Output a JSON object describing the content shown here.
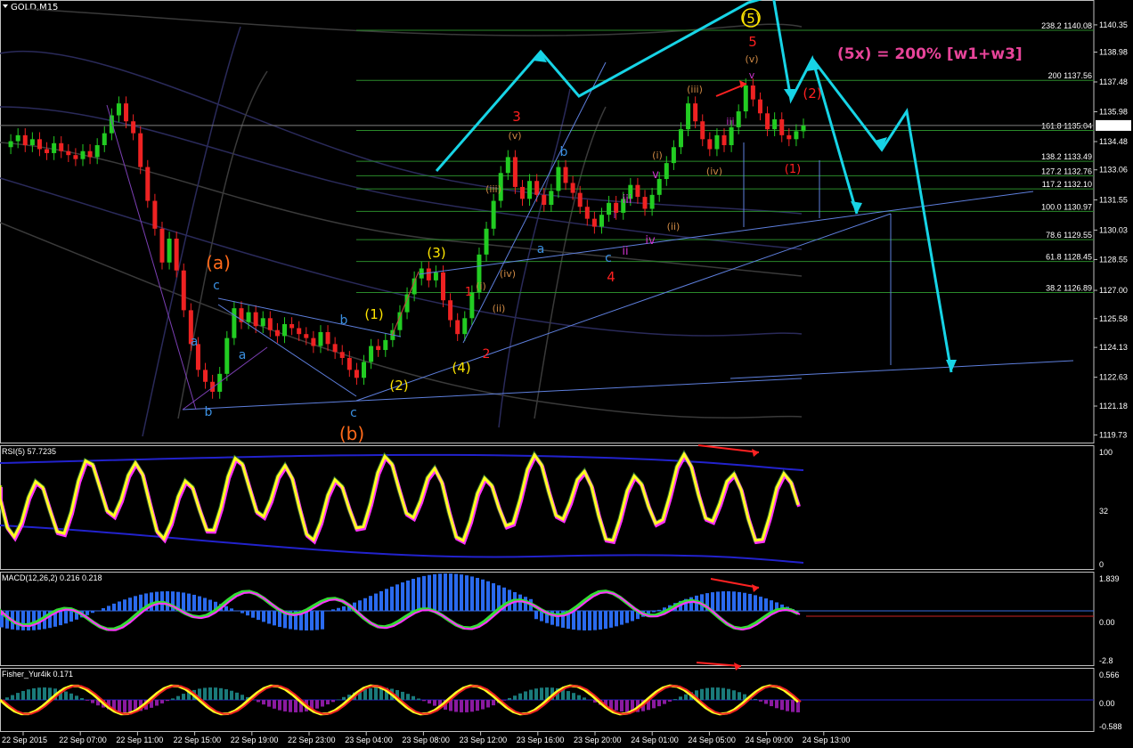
{
  "window": {
    "symbol_title": "GOLD,M15"
  },
  "annotation_main": "(5x)  = 200% [w1+w3]",
  "chart_data": {
    "type": "line",
    "title": "GOLD,M15",
    "price_axis": [
      "1140.35",
      "1138.98",
      "1137.48",
      "1135.98",
      "1134.48",
      "1133.06",
      "1131.55",
      "1130.03",
      "1128.55",
      "1127.00",
      "1125.58",
      "1124.13",
      "1122.63",
      "1121.18",
      "1119.73"
    ],
    "current_price": "1135.29",
    "fib_levels": [
      {
        "label": "238.2 1140.08",
        "price": 1140.08
      },
      {
        "label": "200 1137.56",
        "price": 1137.56
      },
      {
        "label": "161.8 1135.04",
        "price": 1135.04
      },
      {
        "label": "138.2 1133.49",
        "price": 1133.49
      },
      {
        "label": "127.2 1132.76",
        "price": 1132.76
      },
      {
        "label": "117.2 1132.10",
        "price": 1132.1
      },
      {
        "label": "100.0 1130.97",
        "price": 1130.97
      },
      {
        "label": "78.6 1129.55",
        "price": 1129.55
      },
      {
        "label": "61.8 1128.45",
        "price": 1128.45
      },
      {
        "label": "38.2 1126.89",
        "price": 1126.89
      }
    ],
    "date_axis": [
      "22 Sep 2015",
      "22 Sep 07:00",
      "22 Sep 11:00",
      "22 Sep 15:00",
      "22 Sep 19:00",
      "22 Sep 23:00",
      "23 Sep 04:00",
      "23 Sep 08:00",
      "23 Sep 12:00",
      "23 Sep 16:00",
      "23 Sep 20:00",
      "24 Sep 01:00",
      "24 Sep 05:00",
      "24 Sep 09:00",
      "24 Sep 13:00"
    ],
    "wave_labels": [
      "(a)",
      "(b)",
      "(1)",
      "(2)",
      "(3)",
      "(4)",
      "(5)",
      "(2)",
      "(1)",
      "1",
      "2",
      "3",
      "4",
      "5",
      "(v)",
      "(iv)",
      "(iii)",
      "(ii)",
      "(i)",
      "v",
      "iv",
      "iii",
      "ii",
      "i",
      "a",
      "b",
      "c"
    ],
    "indicators": {
      "rsi": {
        "title": "RSI(5) 57.7235",
        "axis": [
          "100",
          "32",
          "0"
        ]
      },
      "macd": {
        "title": "MACD(12,26,2) 0.216 0.218",
        "axis": [
          "1.839",
          "0.00",
          "-2.8"
        ]
      },
      "fisher": {
        "title": "Fisher_Yur4ik 0.171",
        "axis": [
          "0.566",
          "0.00",
          "-0.588"
        ]
      }
    },
    "close_series": [
      1134.2,
      1134.5,
      1134.8,
      1134.3,
      1134.6,
      1134.1,
      1133.9,
      1134.4,
      1134.0,
      1133.8,
      1133.6,
      1134.0,
      1133.7,
      1134.3,
      1134.9,
      1135.8,
      1136.4,
      1135.5,
      1134.9,
      1133.2,
      1131.5,
      1130.1,
      1128.4,
      1129.6,
      1128.0,
      1126.0,
      1124.3,
      1123.0,
      1122.4,
      1121.9,
      1122.8,
      1124.6,
      1126.1,
      1125.4,
      1125.9,
      1125.2,
      1125.6,
      1125.0,
      1124.7,
      1125.3,
      1125.1,
      1124.8,
      1124.6,
      1124.2,
      1124.9,
      1124.3,
      1123.9,
      1123.6,
      1123.0,
      1122.6,
      1123.4,
      1124.2,
      1124.0,
      1124.5,
      1125.0,
      1125.9,
      1126.8,
      1127.6,
      1128.1,
      1127.5,
      1127.9,
      1126.5,
      1125.5,
      1124.8,
      1125.6,
      1126.9,
      1128.8,
      1130.1,
      1131.5,
      1132.9,
      1133.7,
      1132.2,
      1131.6,
      1132.5,
      1131.8,
      1131.3,
      1132.0,
      1133.2,
      1132.4,
      1131.9,
      1131.2,
      1130.6,
      1130.2,
      1130.8,
      1131.4,
      1130.9,
      1131.6,
      1132.3,
      1131.7,
      1131.1,
      1131.8,
      1132.6,
      1133.4,
      1134.2,
      1135.1,
      1136.4,
      1135.5,
      1134.6,
      1134.1,
      1134.8,
      1134.3,
      1135.2,
      1136.0,
      1137.3,
      1136.6,
      1135.9,
      1135.1,
      1135.6,
      1134.8,
      1134.6,
      1135.0,
      1135.29
    ]
  }
}
